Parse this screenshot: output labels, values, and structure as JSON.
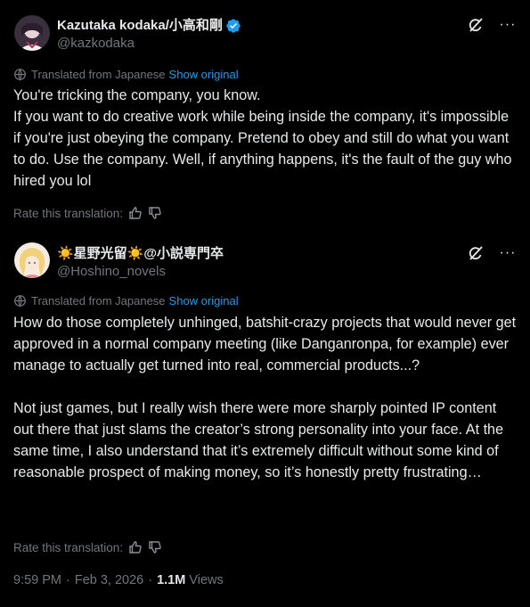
{
  "main_post": {
    "display_name": "Kazutaka kodaka/小高和剛",
    "handle": "@kazkodaka",
    "translated_label": "Translated from Japanese",
    "show_original": "Show original",
    "body": "You're tricking the company, you know.\nIf you want to do creative work while being inside the company, it's impossible if you're just obeying the company. Pretend to obey and still do what you want to do. Use the company. Well, if anything happens, it's the fault of the guy who hired you lol",
    "rate_label": "Rate this translation:",
    "more_label": "···"
  },
  "quoted_post": {
    "display_name": "☀️星野光留☀️@小説専門卒",
    "handle": "@Hoshino_novels",
    "translated_label": "Translated from Japanese",
    "show_original": "Show original",
    "body": "How do those completely unhinged, batshit-crazy projects that would never get approved in a normal company meeting (like Danganronpa, for example) ever manage to actually get turned into real, commercial products...?\n\nNot just games, but I really wish there were more sharply pointed IP content out there that just slams the creator’s strong personality into your face. At the same time, I also understand that it’s extremely difficult without some kind of reasonable prospect of making money, so it’s honestly pretty frustrating…",
    "rate_label": "Rate this translation:",
    "more_label": "···"
  },
  "meta": {
    "time": "9:59 PM",
    "separator": "·",
    "date": "Feb 3, 2026",
    "views_count": "1.1M",
    "views_label": "Views"
  },
  "colors": {
    "background": "#000000",
    "text": "#e7e9ea",
    "muted": "#71767b",
    "link": "#1d9bf0",
    "verified": "#1d9bf0"
  },
  "icons": {
    "verified": "verified-badge-icon",
    "grok": "grok-icon",
    "more": "more-icon",
    "globe": "translate-icon",
    "thumbs_up": "thumbs-up-icon",
    "thumbs_down": "thumbs-down-icon"
  }
}
